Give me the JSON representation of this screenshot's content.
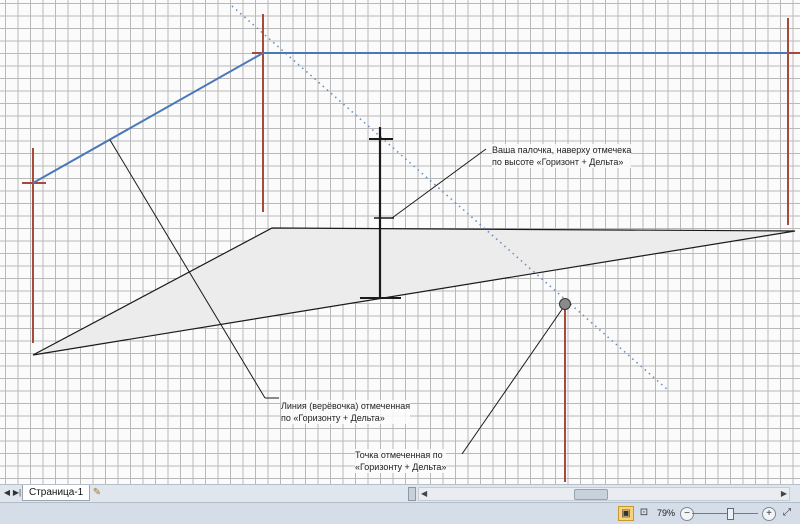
{
  "annotations": {
    "stick": [
      "Ваша палочка, наверху отмечека",
      "по высоте «Горизонт + Дельта»"
    ],
    "rope": [
      "Линия (верёвочка) отмеченная",
      "по «Горизонту + Дельта»"
    ],
    "point": [
      "Точка отмеченная по",
      "«Горизонту + Дельта»"
    ]
  },
  "tabs": {
    "page_tab": "Страница-1"
  },
  "status": {
    "zoom": "79%"
  },
  "icons": {
    "first": "first-page-icon",
    "prev": "prev-page-icon",
    "insert": "insert-page-icon",
    "scroll_left": "scroll-left-icon",
    "scroll_right": "scroll-right-icon",
    "fit_page": "fit-page-icon",
    "full_screen": "full-screen-icon",
    "zoom_out": "zoom-out-icon",
    "zoom_in": "zoom-in-icon",
    "pan": "pan-window-icon"
  },
  "colors": {
    "stake_red": "#a84a3a",
    "string_blue": "#4a78b8",
    "dotted_blue": "#6a8fc0",
    "outline": "#1a1a1a",
    "surface_fill": "#ececec",
    "point_fill": "#8a8a8a"
  }
}
